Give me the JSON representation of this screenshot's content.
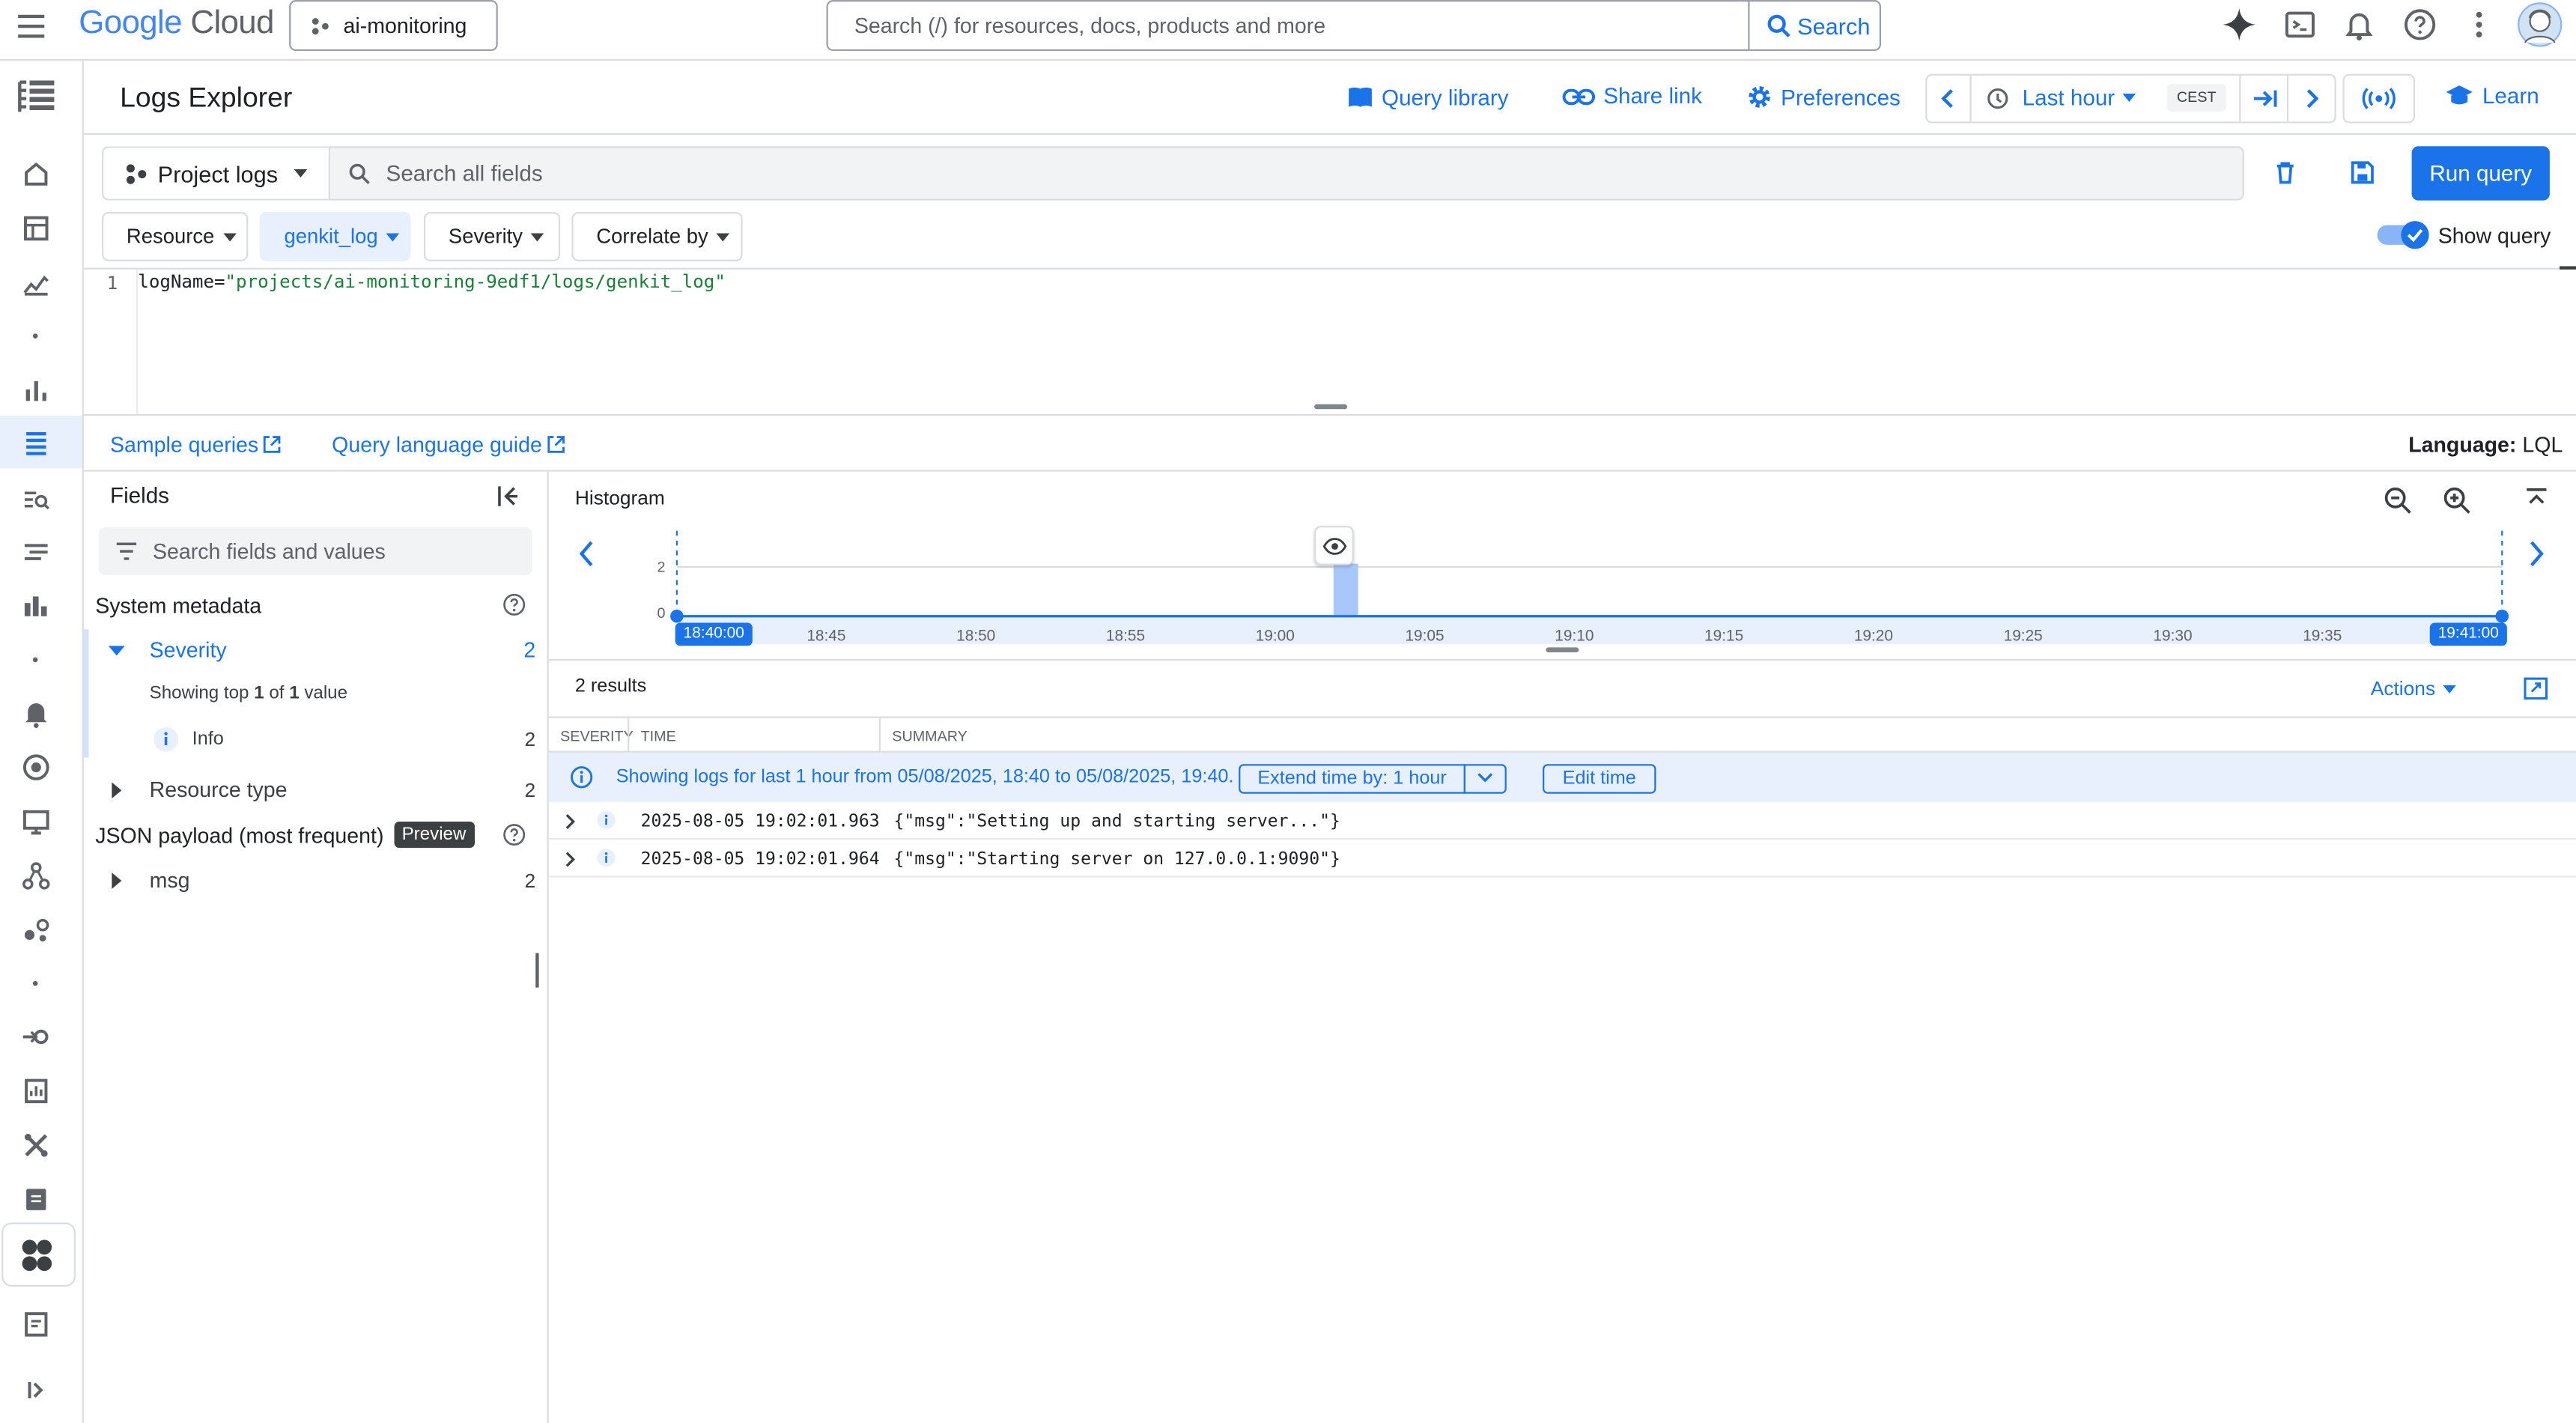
{
  "topbar": {
    "logo_word1": "Google",
    "logo_word2": "Cloud",
    "project_name": "ai-monitoring",
    "search_placeholder": "Search (/) for resources, docs, products and more",
    "search_button": "Search"
  },
  "header": {
    "title": "Logs Explorer",
    "query_library": "Query library",
    "share_link": "Share link",
    "preferences": "Preferences",
    "time_range": "Last hour",
    "timezone": "CEST",
    "learn": "Learn"
  },
  "query": {
    "scope": "Project logs",
    "search_placeholder": "Search all fields",
    "run_query": "Run query",
    "chips": [
      "Resource",
      "genkit_log",
      "Severity",
      "Correlate by"
    ],
    "show_query": "Show query",
    "line_number": "1",
    "code_key": "logName=",
    "code_value": "\"projects/ai-monitoring-9edf1/logs/genkit_log\""
  },
  "links": {
    "sample_queries": "Sample queries",
    "language_guide": "Query language guide",
    "language_label": "Language:",
    "language_value": "LQL"
  },
  "fields": {
    "title": "Fields",
    "search_placeholder": "Search fields and values",
    "system_metadata": "System metadata",
    "severity": "Severity",
    "severity_count": "2",
    "showing_prefix": "Showing top ",
    "showing_n": "1",
    "showing_mid": " of ",
    "showing_total": "1",
    "showing_suffix": " value",
    "info_label": "Info",
    "info_count": "2",
    "resource_type": "Resource type",
    "resource_count": "2",
    "json_payload": "JSON payload (most frequent)",
    "preview_badge": "Preview",
    "msg": "msg",
    "msg_count": "2"
  },
  "histogram": {
    "title": "Histogram",
    "y_ticks": [
      "2",
      "0"
    ],
    "start_label": "18:40:00",
    "end_label": "19:41:00",
    "ticks": [
      "18:45",
      "18:50",
      "18:55",
      "19:00",
      "19:05",
      "19:10",
      "19:15",
      "19:20",
      "19:25",
      "19:30",
      "19:35"
    ]
  },
  "chart_data": {
    "type": "bar",
    "x": [
      "19:02"
    ],
    "values": [
      2
    ],
    "ylim": [
      0,
      2
    ],
    "xlim": [
      "18:40:00",
      "19:41:00"
    ],
    "grid": true
  },
  "results": {
    "count": "2 results",
    "actions": "Actions",
    "col_severity": "SEVERITY",
    "col_time": "TIME",
    "col_summary": "SUMMARY",
    "info_text": "Showing logs for last 1 hour from 05/08/2025, 18:40 to 05/08/2025, 19:40.",
    "extend_time": "Extend time by: 1 hour",
    "edit_time": "Edit time",
    "rows": [
      {
        "time": "2025-08-05 19:02:01.963",
        "summary": "{\"msg\":\"Setting up and starting server...\"}"
      },
      {
        "time": "2025-08-05 19:02:01.964",
        "summary": "{\"msg\":\"Starting server on 127.0.0.1:9090\"}"
      }
    ]
  },
  "colors": {
    "accent": "#1a73e8",
    "info_bg": "#e8f0fe",
    "histogram_bar": "#a8c7fa"
  }
}
